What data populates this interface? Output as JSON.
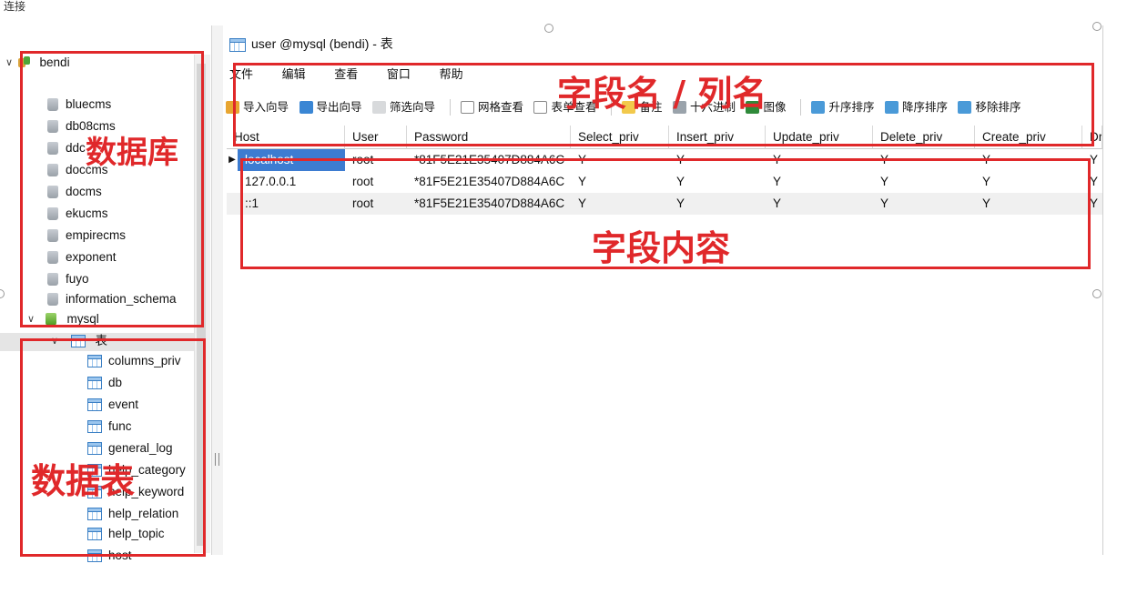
{
  "nav": {
    "header": "连接",
    "connection": "bendi",
    "databases": [
      "bluecms",
      "db08cms",
      "ddc",
      "doccms",
      "docms",
      "ekucms",
      "empirecms",
      "exponent",
      "fuyo",
      "information_schema"
    ],
    "open_db": "mysql",
    "tables_node": "表",
    "tables": [
      "columns_priv",
      "db",
      "event",
      "func",
      "general_log",
      "help_category",
      "help_keyword",
      "help_relation",
      "help_topic",
      "host"
    ]
  },
  "window": {
    "title": "user @mysql (bendi) - 表",
    "menu": [
      "文件",
      "编辑",
      "查看",
      "窗口",
      "帮助"
    ],
    "toolbar": [
      "导入向导",
      "导出向导",
      "筛选向导",
      "网格查看",
      "表单查看",
      "备注",
      "十六进制",
      "图像",
      "升序排序",
      "降序排序",
      "移除排序"
    ]
  },
  "grid": {
    "columns": [
      "Host",
      "User",
      "Password",
      "Select_priv",
      "Insert_priv",
      "Update_priv",
      "Delete_priv",
      "Create_priv",
      "Dr"
    ],
    "rows": [
      [
        "localhost",
        "root",
        "*81F5E21E35407D884A6C",
        "Y",
        "Y",
        "Y",
        "Y",
        "Y",
        "Y"
      ],
      [
        "127.0.0.1",
        "root",
        "*81F5E21E35407D884A6C",
        "Y",
        "Y",
        "Y",
        "Y",
        "Y",
        "Y"
      ],
      [
        "::1",
        "root",
        "*81F5E21E35407D884A6C",
        "Y",
        "Y",
        "Y",
        "Y",
        "Y",
        "Y"
      ]
    ]
  },
  "annotations": {
    "databases": "数据库",
    "tables": "数据表",
    "columns": "字段名 / 列名",
    "content": "字段内容"
  },
  "colors": {
    "annotation": "#e0282a",
    "selection": "#3d7cd1"
  }
}
